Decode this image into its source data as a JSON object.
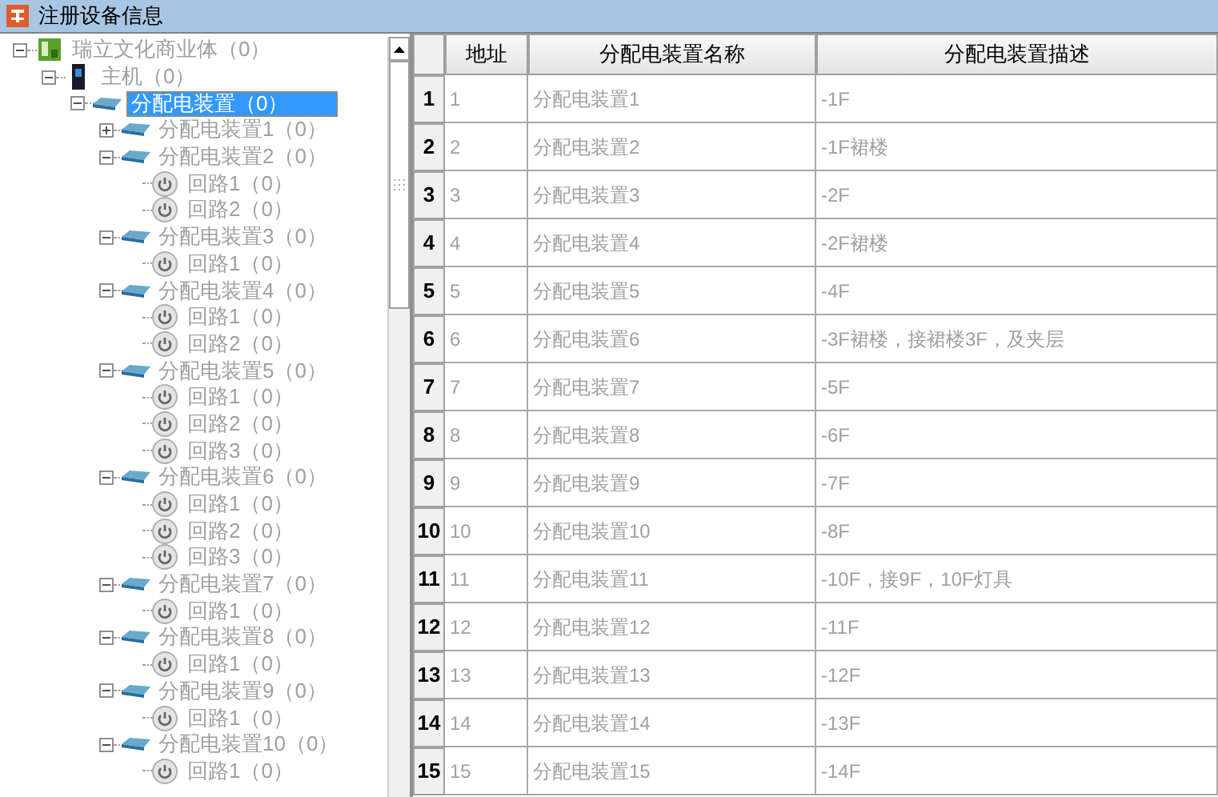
{
  "window": {
    "title": "注册设备信息"
  },
  "tree": [
    {
      "kind": "site",
      "label": "瑞立文化商业体（0）",
      "expanded": true,
      "selected": false,
      "children": [
        {
          "kind": "host",
          "label": "主机（0）",
          "expanded": true,
          "selected": false,
          "children": [
            {
              "kind": "group",
              "label": "分配电装置（0）",
              "expanded": true,
              "selected": true,
              "children": [
                {
                  "kind": "device",
                  "label": "分配电装置1（0）",
                  "expanded": false,
                  "selected": false
                },
                {
                  "kind": "device",
                  "label": "分配电装置2（0）",
                  "expanded": true,
                  "selected": false,
                  "children": [
                    {
                      "kind": "loop",
                      "label": "回路1（0）",
                      "selected": false
                    },
                    {
                      "kind": "loop",
                      "label": "回路2（0）",
                      "selected": false
                    }
                  ]
                },
                {
                  "kind": "device",
                  "label": "分配电装置3（0）",
                  "expanded": true,
                  "selected": false,
                  "children": [
                    {
                      "kind": "loop",
                      "label": "回路1（0）",
                      "selected": false
                    }
                  ]
                },
                {
                  "kind": "device",
                  "label": "分配电装置4（0）",
                  "expanded": true,
                  "selected": false,
                  "children": [
                    {
                      "kind": "loop",
                      "label": "回路1（0）",
                      "selected": false
                    },
                    {
                      "kind": "loop",
                      "label": "回路2（0）",
                      "selected": false
                    }
                  ]
                },
                {
                  "kind": "device",
                  "label": "分配电装置5（0）",
                  "expanded": true,
                  "selected": false,
                  "children": [
                    {
                      "kind": "loop",
                      "label": "回路1（0）",
                      "selected": false
                    },
                    {
                      "kind": "loop",
                      "label": "回路2（0）",
                      "selected": false
                    },
                    {
                      "kind": "loop",
                      "label": "回路3（0）",
                      "selected": false
                    }
                  ]
                },
                {
                  "kind": "device",
                  "label": "分配电装置6（0）",
                  "expanded": true,
                  "selected": false,
                  "children": [
                    {
                      "kind": "loop",
                      "label": "回路1（0）",
                      "selected": false
                    },
                    {
                      "kind": "loop",
                      "label": "回路2（0）",
                      "selected": false
                    },
                    {
                      "kind": "loop",
                      "label": "回路3（0）",
                      "selected": false
                    }
                  ]
                },
                {
                  "kind": "device",
                  "label": "分配电装置7（0）",
                  "expanded": true,
                  "selected": false,
                  "children": [
                    {
                      "kind": "loop",
                      "label": "回路1（0）",
                      "selected": false
                    }
                  ]
                },
                {
                  "kind": "device",
                  "label": "分配电装置8（0）",
                  "expanded": true,
                  "selected": false,
                  "children": [
                    {
                      "kind": "loop",
                      "label": "回路1（0）",
                      "selected": false
                    }
                  ]
                },
                {
                  "kind": "device",
                  "label": "分配电装置9（0）",
                  "expanded": true,
                  "selected": false,
                  "children": [
                    {
                      "kind": "loop",
                      "label": "回路1（0）",
                      "selected": false
                    }
                  ]
                },
                {
                  "kind": "device",
                  "label": "分配电装置10（0）",
                  "expanded": true,
                  "selected": false,
                  "children": [
                    {
                      "kind": "loop",
                      "label": "回路1（0）",
                      "selected": false
                    }
                  ]
                }
              ]
            }
          ]
        }
      ]
    }
  ],
  "table": {
    "columns": [
      "地址",
      "分配电装置名称",
      "分配电装置描述"
    ],
    "rows": [
      {
        "number": "1",
        "cells": [
          "1",
          "分配电装置1",
          "-1F"
        ]
      },
      {
        "number": "2",
        "cells": [
          "2",
          "分配电装置2",
          "-1F裙楼"
        ]
      },
      {
        "number": "3",
        "cells": [
          "3",
          "分配电装置3",
          "-2F"
        ]
      },
      {
        "number": "4",
        "cells": [
          "4",
          "分配电装置4",
          "-2F裙楼"
        ]
      },
      {
        "number": "5",
        "cells": [
          "5",
          "分配电装置5",
          "-4F"
        ]
      },
      {
        "number": "6",
        "cells": [
          "6",
          "分配电装置6",
          "-3F裙楼，接裙楼3F，及夹层"
        ]
      },
      {
        "number": "7",
        "cells": [
          "7",
          "分配电装置7",
          "-5F"
        ]
      },
      {
        "number": "8",
        "cells": [
          "8",
          "分配电装置8",
          "-6F"
        ]
      },
      {
        "number": "9",
        "cells": [
          "9",
          "分配电装置9",
          "-7F"
        ]
      },
      {
        "number": "10",
        "cells": [
          "10",
          "分配电装置10",
          "-8F"
        ]
      },
      {
        "number": "11",
        "cells": [
          "11",
          "分配电装置11",
          "-10F，接9F，10F灯具"
        ]
      },
      {
        "number": "12",
        "cells": [
          "12",
          "分配电装置12",
          "-11F"
        ]
      },
      {
        "number": "13",
        "cells": [
          "13",
          "分配电装置13",
          "-12F"
        ]
      },
      {
        "number": "14",
        "cells": [
          "14",
          "分配电装置14",
          "-13F"
        ]
      },
      {
        "number": "15",
        "cells": [
          "15",
          "分配电装置15",
          "-14F"
        ]
      }
    ]
  }
}
